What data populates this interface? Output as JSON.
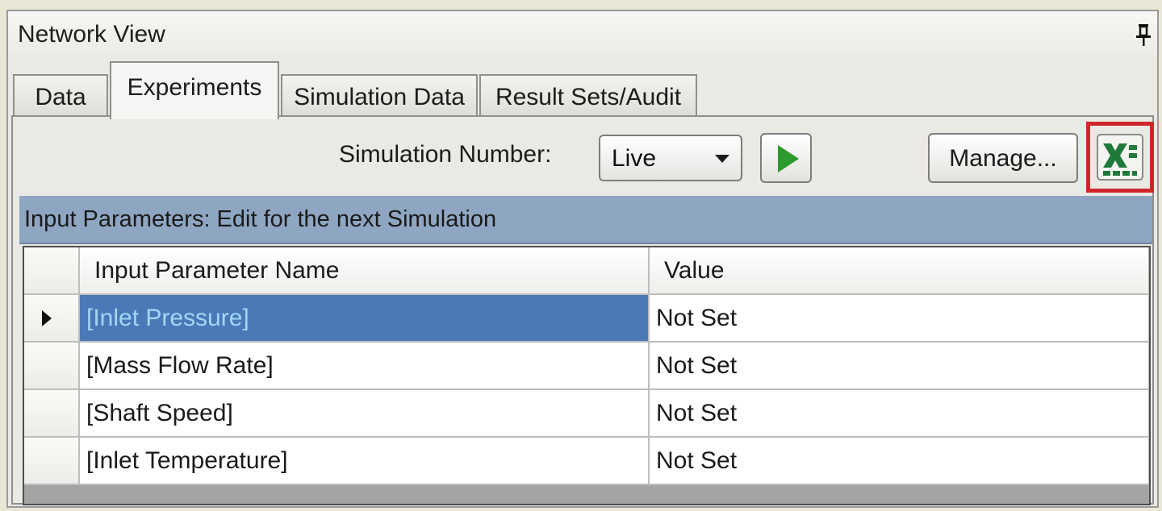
{
  "window": {
    "title": "Network View",
    "pin_icon": "pin-icon"
  },
  "tabs": [
    {
      "label": "Data",
      "active": false
    },
    {
      "label": "Experiments",
      "active": true
    },
    {
      "label": "Simulation Data",
      "active": false
    },
    {
      "label": "Result Sets/Audit",
      "active": false
    }
  ],
  "toolbar": {
    "simulation_label": "Simulation Number:",
    "simulation_value": "Live",
    "run_icon": "play-icon",
    "manage_label": "Manage...",
    "export_icon": "excel-icon",
    "highlight_color": "#d0262b"
  },
  "section": {
    "title": "Input Parameters: Edit for the next Simulation"
  },
  "grid": {
    "columns": [
      "Input Parameter Name",
      "Value"
    ],
    "rows": [
      {
        "name": "[Inlet Pressure]",
        "value": "Not Set",
        "selected": true
      },
      {
        "name": "[Mass Flow Rate]",
        "value": "Not Set",
        "selected": false
      },
      {
        "name": "[Shaft Speed]",
        "value": "Not Set",
        "selected": false
      },
      {
        "name": "[Inlet Temperature]",
        "value": "Not Set",
        "selected": false
      }
    ]
  },
  "colors": {
    "selection": "#4d78b8",
    "section_header": "#8fa6c2",
    "run_green": "#2c9a2c",
    "excel_green": "#1f7a3a"
  }
}
